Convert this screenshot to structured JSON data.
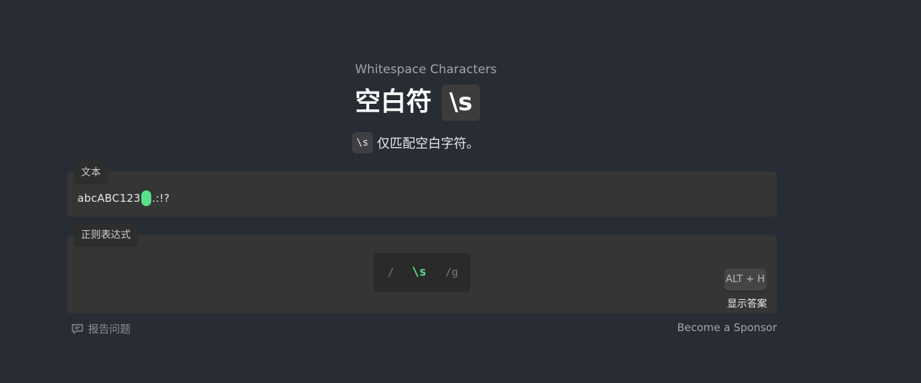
{
  "lesson": {
    "subtitle": "Whitespace Characters",
    "title": "空白符",
    "title_code": "\\s",
    "description_code": "\\s",
    "description": "仅匹配空白字符。"
  },
  "text_panel": {
    "label": "文本",
    "before": "abcABC123",
    "after": ".:!?"
  },
  "regex_panel": {
    "label": "正则表达式",
    "open": "/",
    "body": "\\s",
    "flags": "/g",
    "hint_key": "ALT + H",
    "hint_label": "显示答案"
  },
  "footer": {
    "report": "报告问题",
    "sponsor": "Become a Sponsor"
  },
  "colors": {
    "background": "#282c34",
    "panel": "#353535",
    "match_highlight": "#58e08b"
  },
  "icons": {
    "report": "comment-icon"
  }
}
